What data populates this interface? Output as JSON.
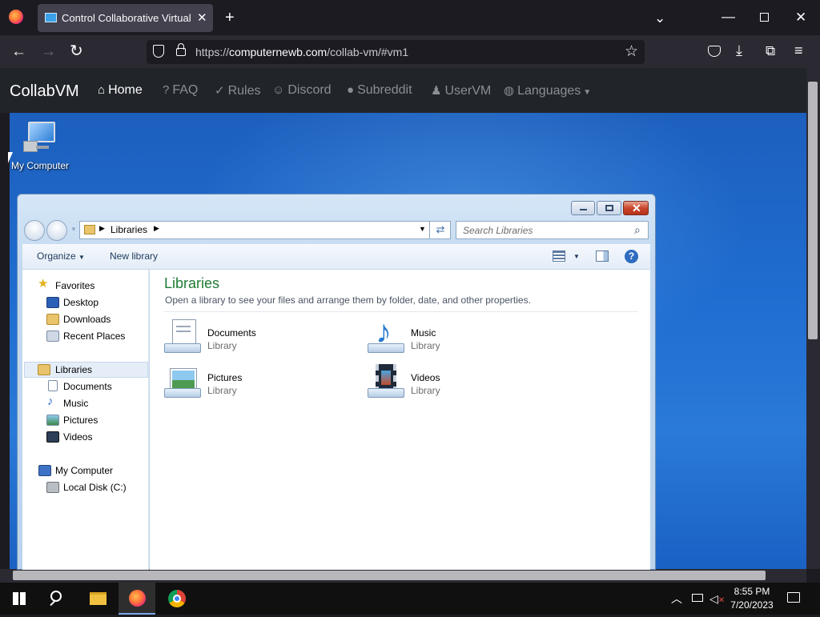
{
  "browser": {
    "tab_title": "Control Collaborative Virtual M",
    "url_prefix": "https://",
    "url_domain": "computernewb.com",
    "url_path": "/collab-vm/#vm1"
  },
  "collabvm": {
    "brand": "CollabVM",
    "nav": [
      {
        "label": "Home",
        "icon": "home-icon"
      },
      {
        "label": "FAQ",
        "icon": "question-icon"
      },
      {
        "label": "Rules",
        "icon": "clipboard-icon"
      },
      {
        "label": "Discord",
        "icon": "discord-icon"
      },
      {
        "label": "Subreddit",
        "icon": "reddit-icon"
      },
      {
        "label": "UserVM",
        "icon": "user-icon"
      },
      {
        "label": "Languages",
        "icon": "globe-icon"
      }
    ]
  },
  "desktop": {
    "icons": [
      {
        "label": "My Computer",
        "icon": "my-computer-icon"
      }
    ]
  },
  "explorer": {
    "breadcrumb": "Libraries",
    "search_placeholder": "Search Libraries",
    "toolbar": {
      "organize": "Organize",
      "new_library": "New library"
    },
    "nav": {
      "favorites": {
        "label": "Favorites",
        "items": [
          "Desktop",
          "Downloads",
          "Recent Places"
        ]
      },
      "libraries": {
        "label": "Libraries",
        "items": [
          "Documents",
          "Music",
          "Pictures",
          "Videos"
        ]
      },
      "computer": {
        "label": "My Computer",
        "items": [
          "Local Disk (C:)"
        ]
      }
    },
    "heading": "Libraries",
    "description": "Open a library to see your files and arrange them by folder, date, and other properties.",
    "libraries": [
      {
        "name": "Documents",
        "type": "Library"
      },
      {
        "name": "Music",
        "type": "Library"
      },
      {
        "name": "Pictures",
        "type": "Library"
      },
      {
        "name": "Videos",
        "type": "Library"
      }
    ]
  },
  "taskbar": {
    "time": "8:55 PM",
    "date": "7/20/2023"
  },
  "colors": {
    "accent": "#1e6bd0",
    "heading_green": "#1e7b34"
  }
}
